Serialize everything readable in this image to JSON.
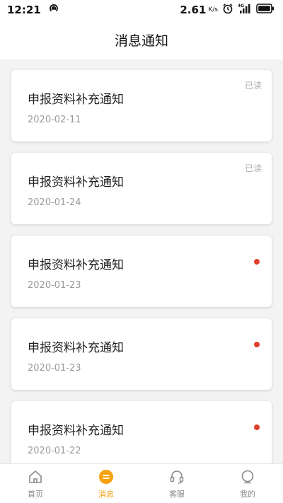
{
  "status_bar": {
    "time": "12:21",
    "speed": "2.61",
    "speed_unit": "K/s",
    "network": "4G",
    "icons": [
      "hotspot-icon",
      "alarm-icon",
      "signal-icon",
      "battery-icon"
    ]
  },
  "header": {
    "title": "消息通知"
  },
  "colors": {
    "accent": "#f5a20e",
    "unread": "#e0402c"
  },
  "messages": [
    {
      "title": "申报资料补充通知",
      "date": "2020-02-11",
      "status": "已读",
      "read": true
    },
    {
      "title": "申报资料补充通知",
      "date": "2020-01-24",
      "status": "已读",
      "read": true
    },
    {
      "title": "申报资料补充通知",
      "date": "2020-01-23",
      "status": "",
      "read": false
    },
    {
      "title": "申报资料补充通知",
      "date": "2020-01-23",
      "status": "",
      "read": false
    },
    {
      "title": "申报资料补充通知",
      "date": "2020-01-22",
      "status": "",
      "read": false
    }
  ],
  "tabbar": {
    "active_index": 1,
    "items": [
      {
        "label": "首页",
        "icon": "home-icon"
      },
      {
        "label": "消息",
        "icon": "message-icon"
      },
      {
        "label": "客服",
        "icon": "headset-icon"
      },
      {
        "label": "我的",
        "icon": "profile-icon"
      }
    ]
  }
}
